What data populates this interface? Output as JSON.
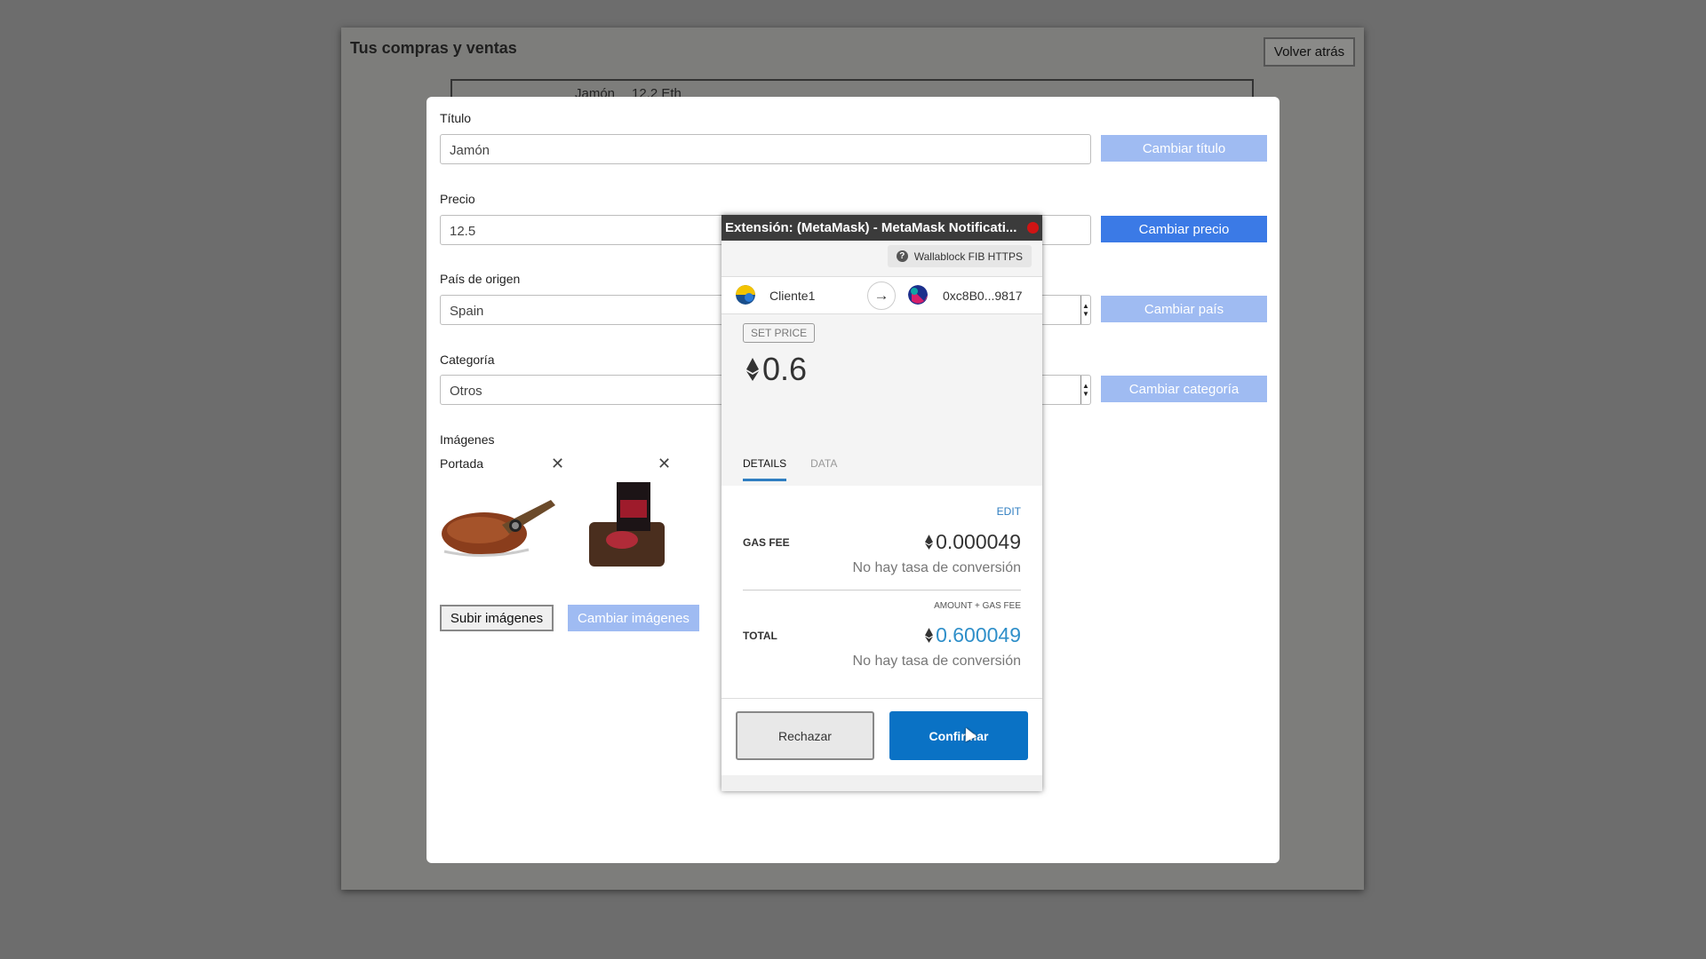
{
  "background_page": {
    "title": "Tus compras y ventas",
    "back_button": "Volver atrás",
    "row_text": "Jamón",
    "row_price": "12.2 Eth"
  },
  "form": {
    "title_label": "Título",
    "title_value": "Jamón",
    "title_button": "Cambiar título",
    "price_label": "Precio",
    "price_value": "12.5",
    "price_button": "Cambiar precio",
    "country_label": "País de origen",
    "country_value": "Spain",
    "country_button": "Cambiar país",
    "category_label": "Categoría",
    "category_value": "Otros",
    "category_button": "Cambiar categoría",
    "images_label": "Imágenes",
    "cover_caption": "Portada",
    "upload_button": "Subir imágenes",
    "change_images_button": "Cambiar imágenes"
  },
  "metamask": {
    "window_title": "Extensión: (MetaMask) - MetaMask Notificati...",
    "network": "Wallablock FIB HTTPS",
    "from_account": "Cliente1",
    "to_account": "0xc8B0...9817",
    "method": "SET PRICE",
    "amount": "0.6",
    "tabs": [
      "DETAILS",
      "DATA"
    ],
    "edit": "EDIT",
    "gas_fee_label": "GAS FEE",
    "gas_fee_value": "0.000049",
    "no_conversion": "No hay tasa de conversión",
    "amount_gas_label": "AMOUNT + GAS FEE",
    "total_label": "TOTAL",
    "total_value": "0.600049",
    "reject_button": "Rechazar",
    "confirm_button": "Confirmar"
  },
  "colors": {
    "overlay": "#6d6d6d",
    "button_disabled": "#9fbbf2",
    "button_active": "#3b7ae6",
    "metamask_blue": "#0a72c5",
    "total_blue": "#2f8fc9"
  }
}
